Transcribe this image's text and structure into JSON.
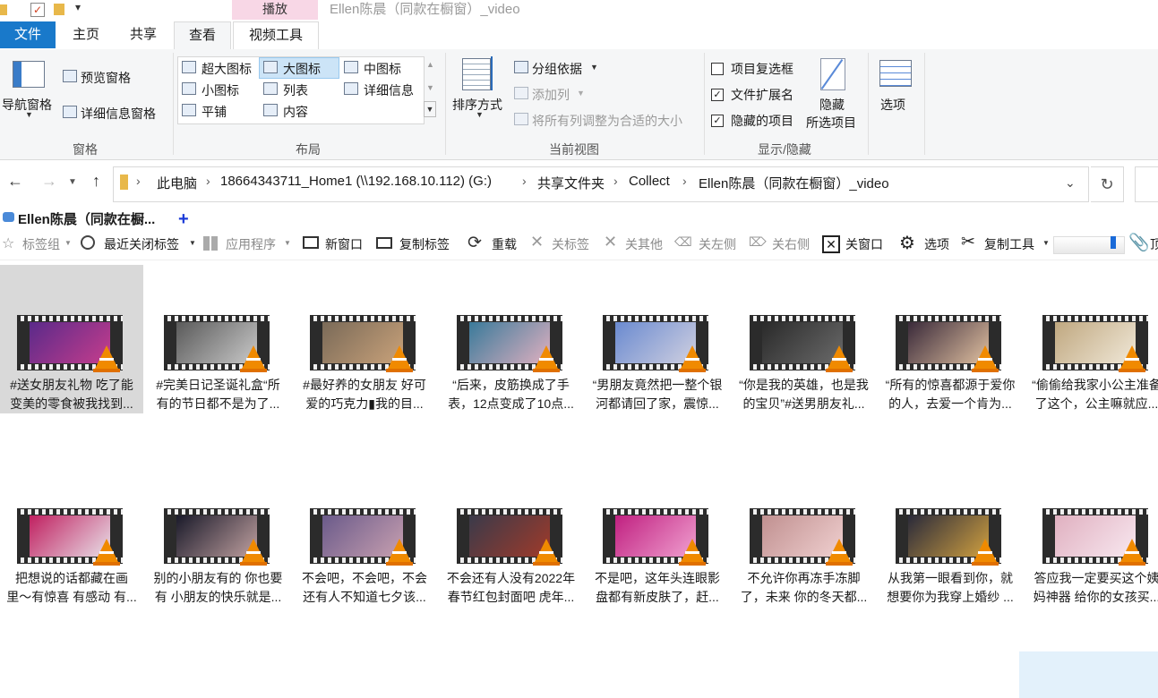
{
  "window": {
    "title": "Ellen陈晨（同款在橱窗）_video",
    "context_group": "播放"
  },
  "ribbon_tabs": [
    "文件",
    "主页",
    "共享",
    "查看",
    "视频工具"
  ],
  "ribbon": {
    "panes": {
      "nav_pane": "导航窗格",
      "preview_pane": "预览窗格",
      "details_pane": "详细信息窗格",
      "label": "窗格"
    },
    "layout": {
      "items": [
        "超大图标",
        "大图标",
        "中图标",
        "小图标",
        "列表",
        "详细信息",
        "平铺",
        "内容"
      ],
      "label": "布局"
    },
    "current_view": {
      "sort": "排序方式",
      "group_by": "分组依据",
      "add_column": "添加列",
      "fit_columns": "将所有列调整为合适的大小",
      "label": "当前视图"
    },
    "show_hide": {
      "item_checkboxes": "项目复选框",
      "file_extensions": "文件扩展名",
      "hidden_items": "隐藏的项目",
      "hide_selected_1": "隐藏",
      "hide_selected_2": "所选项目",
      "label": "显示/隐藏"
    },
    "options": "选项"
  },
  "address": {
    "crumbs": [
      "此电脑",
      "18664343711_Home1 (\\\\192.168.10.112) (G:)",
      "共享文件夹",
      "Collect",
      "Ellen陈晨（同款在橱窗）_video"
    ]
  },
  "tabstrip": {
    "active_tab": "Ellen陈晨（同款在橱...",
    "add": "+"
  },
  "toolbar": {
    "bookmarks": "标签组",
    "recent_closed": "最近关闭标签",
    "apps": "应用程序",
    "new_window": "新窗口",
    "copy_tab": "复制标签",
    "reload": "重载",
    "close_tab": "关标签",
    "close_others": "关其他",
    "close_left": "关左侧",
    "close_right": "关右侧",
    "close_window": "关窗口",
    "options": "选项",
    "copy_tool": "复制工具",
    "more": "顶"
  },
  "files": [
    {
      "l1": "#送女朋友礼物 吃了能",
      "l2": "变美的零食被我找到...",
      "c1": "#5a2a8a",
      "c2": "#c63d8c"
    },
    {
      "l1": "#完美日记圣诞礼盒“所",
      "l2": "有的节日都不是为了...",
      "c1": "#5a5a5a",
      "c2": "#c9c9c9"
    },
    {
      "l1": "#最好养的女朋友 好可",
      "l2": "爱的巧克力▮我的目...",
      "c1": "#7a6a58",
      "c2": "#c9a27a"
    },
    {
      "l1": "“后来，皮筋换成了手",
      "l2": "表，12点变成了10点...",
      "c1": "#3a7a9a",
      "c2": "#e0b0c0"
    },
    {
      "l1": "“男朋友竟然把一整个银",
      "l2": "河都请回了家，震惊...",
      "c1": "#6a8ad0",
      "c2": "#d0d0e0"
    },
    {
      "l1": "“你是我的英雄，也是我",
      "l2": "的宝贝”#送男朋友礼...",
      "c1": "#2a2a2a",
      "c2": "#6a6a6a"
    },
    {
      "l1": "“所有的惊喜都源于爱你",
      "l2": "的人，去爱一个肯为...",
      "c1": "#3a2a3a",
      "c2": "#e0c0a0"
    },
    {
      "l1": "“偷偷给我家小公主准备",
      "l2": "了这个，公主嘛就应...",
      "c1": "#c0a880",
      "c2": "#f0e8d8"
    },
    {
      "l1": "把想说的话都藏在画",
      "l2": "里～有惊喜 有感动 有...",
      "c1": "#c02060",
      "c2": "#e8e0e8"
    },
    {
      "l1": "别的小朋友有的 你也要",
      "l2": "有 小朋友的快乐就是...",
      "c1": "#1a1a2a",
      "c2": "#c0a0a0"
    },
    {
      "l1": "不会吧，不会吧，不会",
      "l2": "还有人不知道七夕该...",
      "c1": "#6a5a8a",
      "c2": "#c8a0b0"
    },
    {
      "l1": "不会还有人没有2022年",
      "l2": "春节红包封面吧 虎年...",
      "c1": "#3a3a4a",
      "c2": "#a03a2a"
    },
    {
      "l1": "不是吧，这年头连眼影",
      "l2": "盘都有新皮肤了，赶...",
      "c1": "#c02080",
      "c2": "#f0a0d0"
    },
    {
      "l1": "不允许你再冻手冻脚",
      "l2": "了，未来 你的冬天都...",
      "c1": "#c09090",
      "c2": "#f0d0d0"
    },
    {
      "l1": "从我第一眼看到你，就",
      "l2": "想要你为我穿上婚纱 ...",
      "c1": "#2a2a3a",
      "c2": "#d0a040"
    },
    {
      "l1": "答应我一定要买这个姨",
      "l2": "妈神器 给你的女孩买...",
      "c1": "#e0b0c0",
      "c2": "#f8e8f0"
    }
  ]
}
